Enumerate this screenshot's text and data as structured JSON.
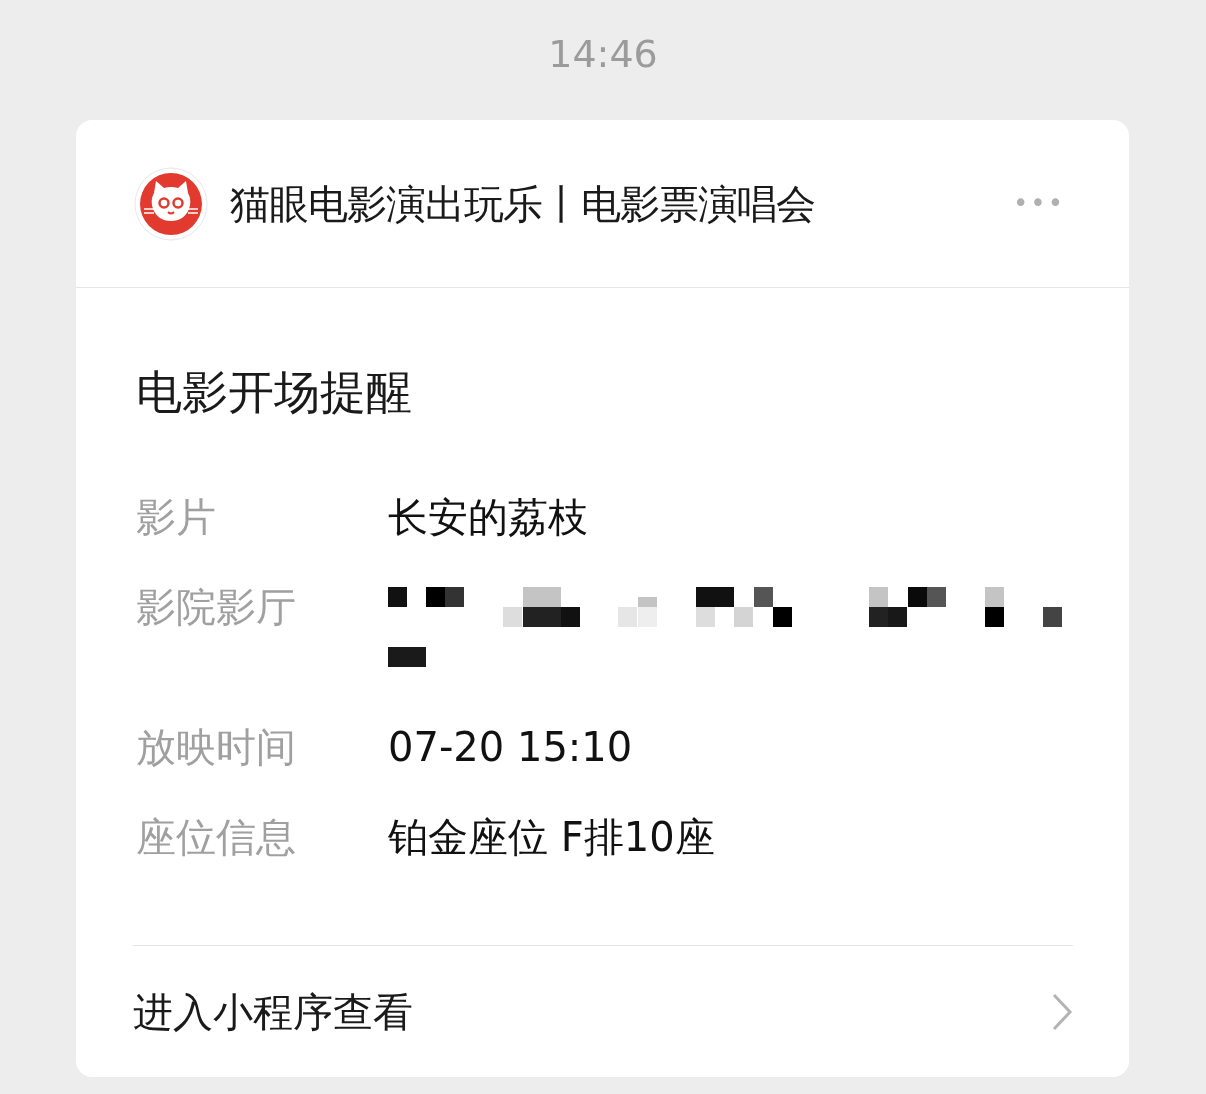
{
  "time": "14:46",
  "account": {
    "name": "猫眼电影演出玩乐丨电影票演唱会",
    "more": "•••"
  },
  "title": "电影开场提醒",
  "fields": [
    {
      "label": "影片",
      "kind": "text",
      "value": "长安的荔枝"
    },
    {
      "label": "影院影厅",
      "kind": "redacted"
    },
    {
      "label": "放映时间",
      "kind": "text",
      "value": "07-20 15:10"
    },
    {
      "label": "座位信息",
      "kind": "text",
      "value": "铂金座位 F排10座"
    }
  ],
  "footer": {
    "label": "进入小程序查看"
  }
}
